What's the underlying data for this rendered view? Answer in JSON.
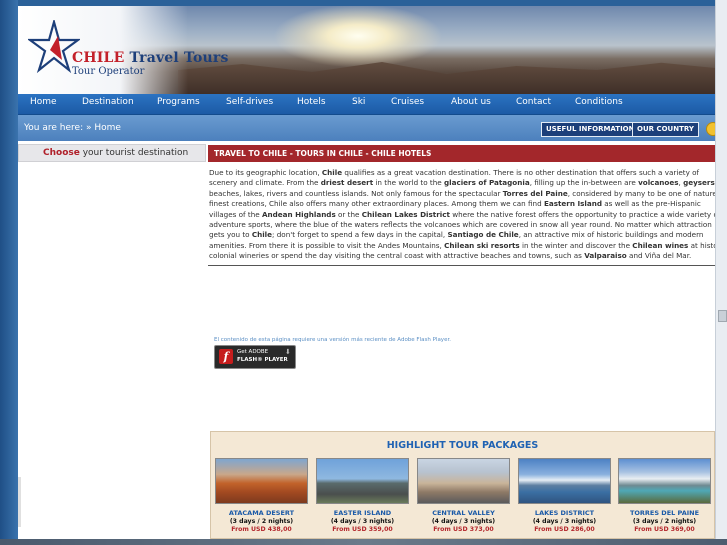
{
  "logo": {
    "brand_red": "CHILE",
    "brand_rest": "Travel Tours",
    "tagline": "Tour Operator"
  },
  "nav": {
    "items": [
      "Home",
      "Destination",
      "Programs",
      "Self-drives",
      "Hotels",
      "Ski",
      "Cruises",
      "About us",
      "Contact",
      "Conditions"
    ]
  },
  "breadcrumb": {
    "prefix": "You are here:",
    "sep": "»",
    "current": "Home"
  },
  "buttons": {
    "useful": "USEFUL INFORMATION",
    "country": "OUR COUNTRY"
  },
  "sidebar": {
    "choose_bold": "Choose",
    "choose_rest": " your tourist destination"
  },
  "main": {
    "heading": "TRAVEL TO CHILE - TOURS IN CHILE - CHILE HOTELS"
  },
  "flash": {
    "note": "El contenido de esta página requiere una versión más reciente de Adobe Flash Player.",
    "get": "Get ADOBE",
    "player": "FLASH® PLAYER"
  },
  "packages": {
    "title": "HIGHLIGHT TOUR PACKAGES",
    "items": [
      {
        "name": "ATACAMA DESERT",
        "duration": "(3 days / 2 nights)",
        "price": "From USD 438,00"
      },
      {
        "name": "EASTER ISLAND",
        "duration": "(4 days / 3 nights)",
        "price": "From USD 359,00"
      },
      {
        "name": "CENTRAL VALLEY",
        "duration": "(4 days / 3 nights)",
        "price": "From USD 373,00"
      },
      {
        "name": "LAKES DISTRICT",
        "duration": "(4 days / 3 nights)",
        "price": "From USD 286,00"
      },
      {
        "name": "TORRES DEL PAINE",
        "duration": "(3 days / 2 nights)",
        "price": "From USD 369,00"
      }
    ]
  },
  "colors": {
    "nav_blue": "#1c5aa5",
    "heading_red": "#a3272b",
    "package_bg": "#f4e8d5",
    "price_red": "#b3262c"
  }
}
